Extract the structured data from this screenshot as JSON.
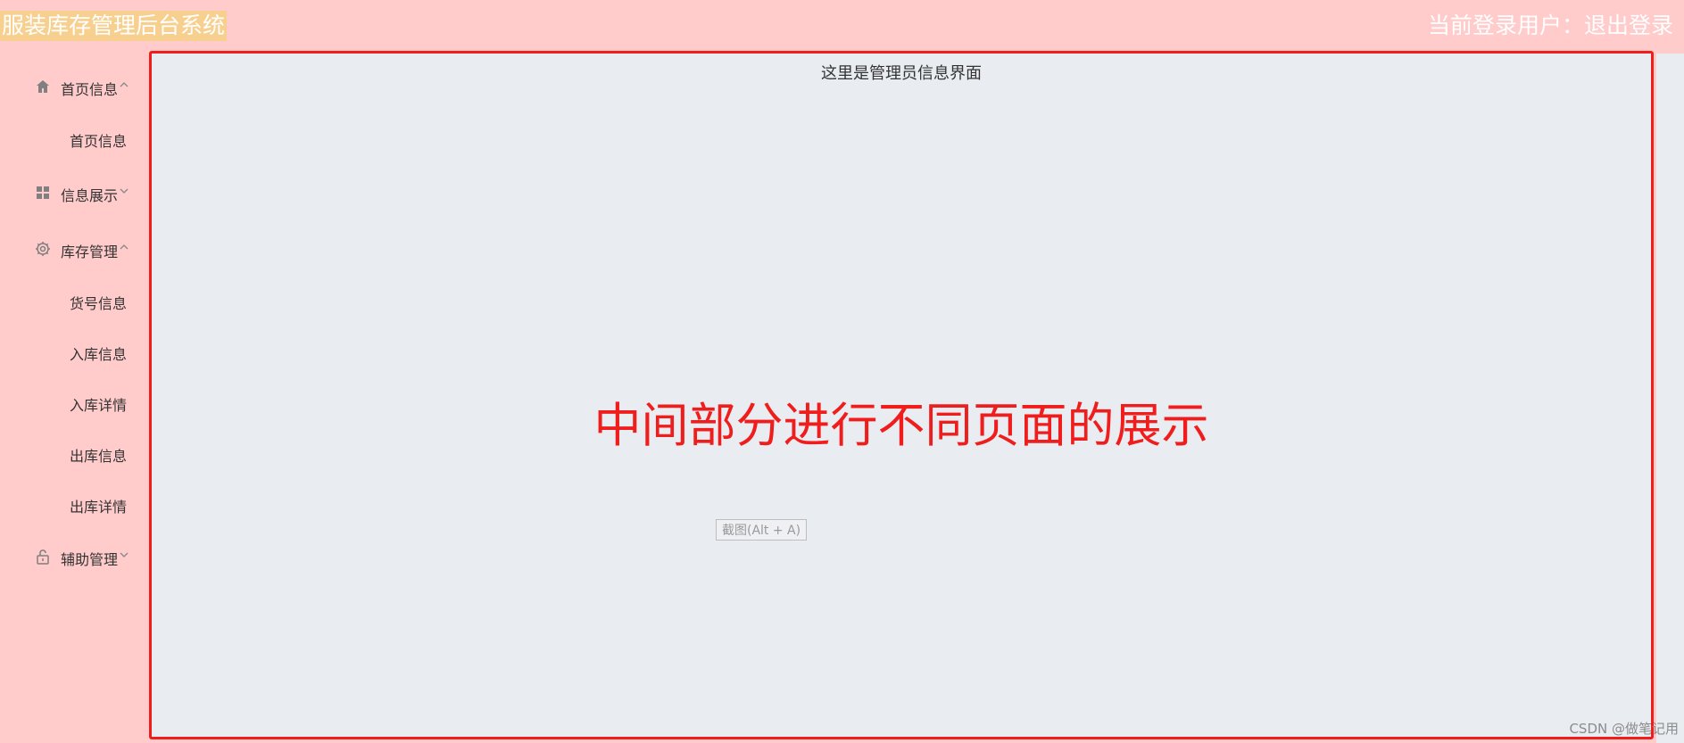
{
  "header": {
    "app_title": "服装库存管理后台系统",
    "current_user_label": "当前登录用户：",
    "logout_label": "退出登录"
  },
  "sidebar": {
    "groups": [
      {
        "label": "首页信息",
        "icon": "home-icon",
        "expanded": true,
        "items": [
          {
            "label": "首页信息"
          }
        ]
      },
      {
        "label": "信息展示",
        "icon": "grid-icon",
        "expanded": false,
        "items": []
      },
      {
        "label": "库存管理",
        "icon": "gear-icon",
        "expanded": true,
        "items": [
          {
            "label": "货号信息"
          },
          {
            "label": "入库信息"
          },
          {
            "label": "入库详情"
          },
          {
            "label": "出库信息"
          },
          {
            "label": "出库详情"
          }
        ]
      },
      {
        "label": "辅助管理",
        "icon": "lock-icon",
        "expanded": false,
        "items": []
      }
    ]
  },
  "main": {
    "caption": "这里是管理员信息界面",
    "annotation": "中间部分进行不同页面的展示",
    "screenshot_hint": "截图(Alt + A)"
  },
  "watermark": "CSDN @做笔记用",
  "colors": {
    "background": "#ffcbcb",
    "content_bg": "#e9ecf1",
    "highlight_border": "#f01d1d",
    "title_highlight": "#f7d08f"
  }
}
